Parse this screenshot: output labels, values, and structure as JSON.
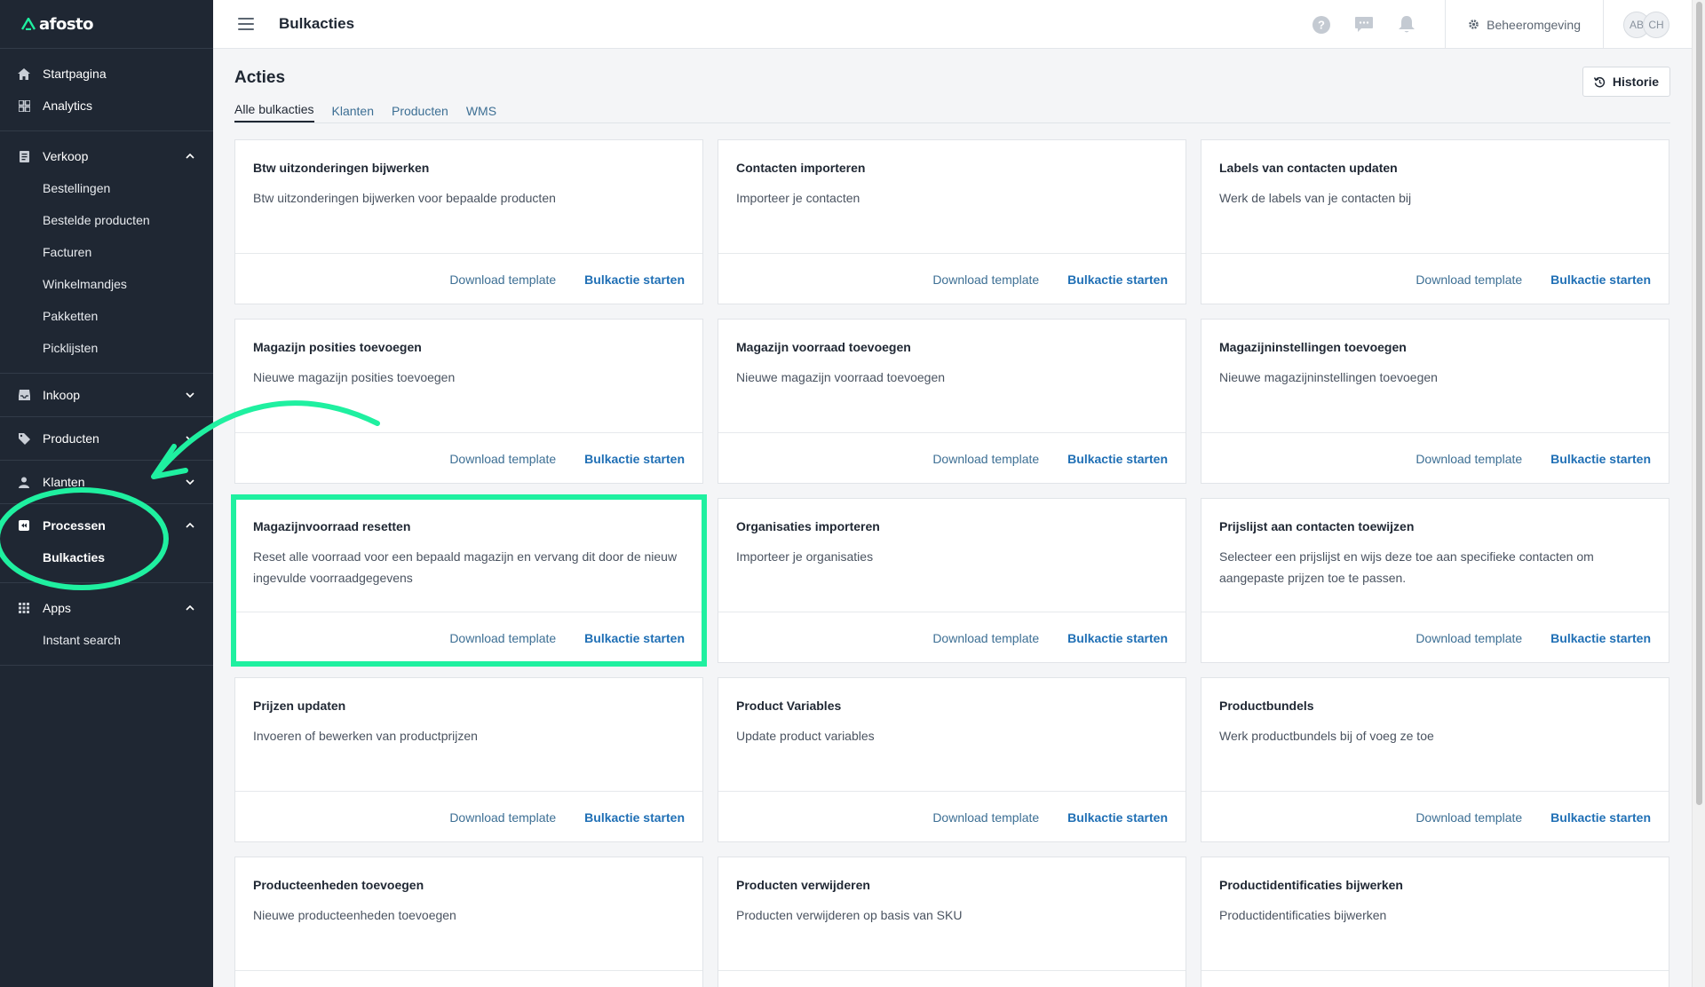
{
  "brand": {
    "name": "afosto",
    "accent": "#1ff0a0"
  },
  "sidebar": {
    "items": [
      {
        "label": "Startpagina",
        "icon": "home-icon"
      },
      {
        "label": "Analytics",
        "icon": "analytics-icon"
      }
    ],
    "groups": [
      {
        "label": "Verkoop",
        "icon": "receipt-icon",
        "expanded": true,
        "children": [
          "Bestellingen",
          "Bestelde producten",
          "Facturen",
          "Winkelmandjes",
          "Pakketten",
          "Picklijsten"
        ]
      },
      {
        "label": "Inkoop",
        "icon": "inbox-icon",
        "expanded": false,
        "children": []
      },
      {
        "label": "Producten",
        "icon": "tag-icon",
        "expanded": false,
        "children": []
      },
      {
        "label": "Klanten",
        "icon": "user-icon",
        "expanded": false,
        "children": []
      },
      {
        "label": "Processen",
        "icon": "process-icon",
        "expanded": true,
        "children": [
          "Bulkacties"
        ]
      },
      {
        "label": "Apps",
        "icon": "apps-grid-icon",
        "expanded": true,
        "children": [
          "Instant search"
        ]
      }
    ]
  },
  "topbar": {
    "title": "Bulkacties",
    "environment": "Beheeromgeving",
    "avatars": [
      "AB",
      "CH"
    ]
  },
  "main": {
    "heading": "Acties",
    "historie_label": "Historie",
    "tabs": [
      "Alle bulkacties",
      "Klanten",
      "Producten",
      "WMS"
    ],
    "download_label": "Download template",
    "start_label": "Bulkactie starten",
    "cards": [
      {
        "title": "Btw uitzonderingen bijwerken",
        "desc": "Btw uitzonderingen bijwerken voor bepaalde producten"
      },
      {
        "title": "Contacten importeren",
        "desc": "Importeer je contacten"
      },
      {
        "title": "Labels van contacten updaten",
        "desc": "Werk de labels van je contacten bij"
      },
      {
        "title": "Magazijn posities toevoegen",
        "desc": "Nieuwe magazijn posities toevoegen"
      },
      {
        "title": "Magazijn voorraad toevoegen",
        "desc": "Nieuwe magazijn voorraad toevoegen"
      },
      {
        "title": "Magazijninstellingen toevoegen",
        "desc": "Nieuwe magazijninstellingen toevoegen"
      },
      {
        "title": "Magazijnvoorraad resetten",
        "desc": "Reset alle voorraad voor een bepaald magazijn en vervang dit door de nieuw ingevulde voorraadgegevens",
        "highlighted": true
      },
      {
        "title": "Organisaties importeren",
        "desc": "Importeer je organisaties"
      },
      {
        "title": "Prijslijst aan contacten toewijzen",
        "desc": "Selecteer een prijslijst en wijs deze toe aan specifieke contacten om aangepaste prijzen toe te passen."
      },
      {
        "title": "Prijzen updaten",
        "desc": "Invoeren of bewerken van productprijzen"
      },
      {
        "title": "Product Variables",
        "desc": "Update product variables"
      },
      {
        "title": "Productbundels",
        "desc": "Werk productbundels bij of voeg ze toe"
      },
      {
        "title": "Producteenheden toevoegen",
        "desc": "Nieuwe producteenheden toevoegen"
      },
      {
        "title": "Producten verwijderen",
        "desc": "Producten verwijderen op basis van SKU"
      },
      {
        "title": "Productidentificaties bijwerken",
        "desc": "Productidentificaties bijwerken"
      }
    ]
  }
}
